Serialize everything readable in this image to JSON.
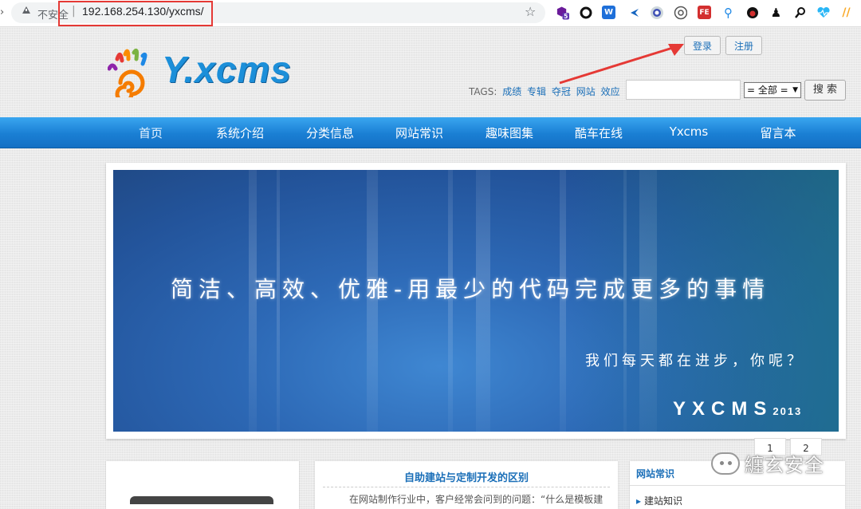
{
  "browser": {
    "security_label": "不安全",
    "separator": "|",
    "url": "192.168.254.130/yxcms/",
    "extension_icons": [
      "hexagon-badge-icon",
      "circle-icon",
      "w-icon",
      "lightning-icon",
      "shield-icon",
      "gauge-icon",
      "fe-icon",
      "pin-icon",
      "drop-icon",
      "ink-icon",
      "search-icon",
      "heartbeat-icon",
      "slash-icon"
    ],
    "extension_badge": "5"
  },
  "site": {
    "logo_text": "Y.xcms",
    "header_buttons": {
      "login": "登录",
      "register": "注册"
    },
    "tags": {
      "label": "TAGS:",
      "items": [
        "成绩",
        "专辑",
        "夺冠",
        "网站",
        "效应",
        "..."
      ]
    },
    "search": {
      "scope": "= 全部 =",
      "button": "搜 索"
    },
    "nav": [
      "首页",
      "系统介绍",
      "分类信息",
      "网站常识",
      "趣味图集",
      "酷车在线",
      "Yxcms",
      "留言本"
    ],
    "banner": {
      "slogan": "简洁、高效、优雅-用最少的代码完成更多的事情",
      "sub_slogan": "我们每天都在进步，你呢？",
      "brand": "YXCMS",
      "year": "2013"
    },
    "pager": [
      "1",
      "2"
    ],
    "article": {
      "title": "自助建站与定制开发的区别",
      "excerpt": "在网站制作行业中，客户经常会问到的问题：“什么是模板建"
    },
    "sidebar": {
      "title": "网站常识",
      "items": [
        "建站知识"
      ]
    }
  },
  "watermark": {
    "text": "纏玄安全"
  },
  "colors": {
    "nav_blue": "#1a7fd4",
    "link_blue": "#1b6fb8",
    "annotation_red": "#e53935",
    "logo_blue": "#1c8fd9"
  }
}
